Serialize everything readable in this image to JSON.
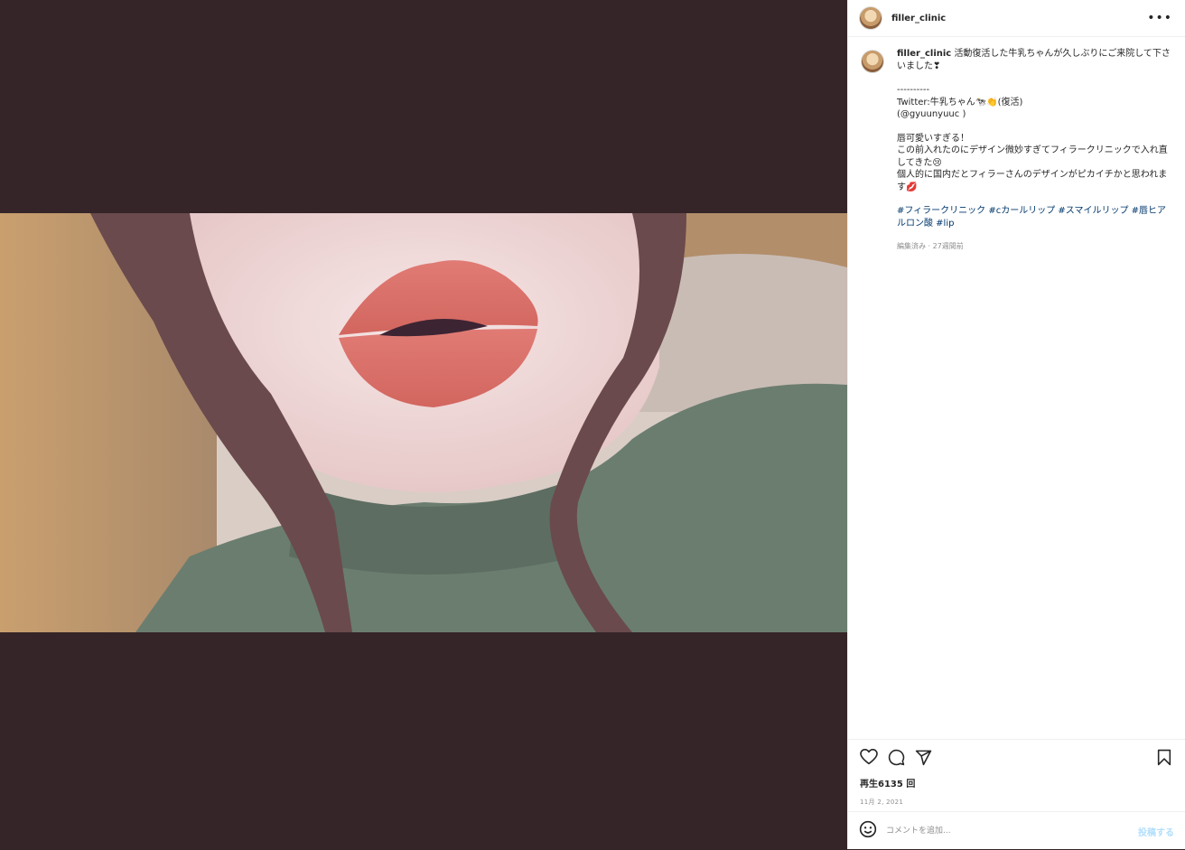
{
  "post": {
    "username": "filler_clinic",
    "more_icon": "more-horizontal-icon"
  },
  "caption": {
    "username": "filler_clinic",
    "line1": "活動復活した牛乳ちゃんが久しぶりにご来院して下さいました❣",
    "divider": "----------",
    "twitter": "Twitter:牛乳ちゃん🐄👏(復活)",
    "handle": "(@gyuunyuuc )",
    "p1": "唇可愛いすぎる！",
    "p2": "この前入れたのにデザイン微妙すぎてフィラークリニックで入れ直してきた😢",
    "p3": "個人的に国内だとフィラーさんのデザインがピカイチかと思われます💋",
    "hashtags": "#フィラークリニック #cカールリップ #スマイルリップ #唇ヒアルロン酸 #lip",
    "meta": "編集済み · 27週間前"
  },
  "stats": {
    "views": "再生6135 回",
    "date": "11月 2, 2021"
  },
  "comment": {
    "placeholder": "コメントを追加...",
    "post_label": "投稿する"
  },
  "colors": {
    "media_bg": "#352528",
    "link": "#00376b",
    "post_button": "#b2dffc"
  }
}
